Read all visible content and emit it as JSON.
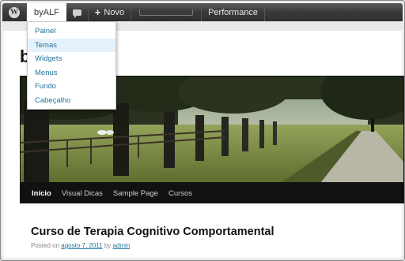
{
  "adminbar": {
    "wp_logo_icon": "wordpress-logo-icon",
    "site_name": "byALF",
    "comments_icon": "speech-bubble-icon",
    "new_label": "Novo",
    "performance_label": "Performance"
  },
  "site_menu": {
    "items": [
      {
        "label": "Painel"
      },
      {
        "label": "Temas"
      },
      {
        "label": "Widgets"
      },
      {
        "label": "Menus"
      },
      {
        "label": "Fundo"
      },
      {
        "label": "Cabeçalho"
      }
    ],
    "highlighted_index": 1
  },
  "site": {
    "title": "b"
  },
  "nav": {
    "items": [
      {
        "label": "Início"
      },
      {
        "label": "Visual Dicas"
      },
      {
        "label": "Sample Page"
      },
      {
        "label": "Cursos"
      }
    ]
  },
  "post": {
    "title": "Curso de Terapia Cognitivo Comportamental",
    "posted_on_label": "Posted on",
    "date": "agosto 7, 2011",
    "by_label": "by",
    "author": "admin"
  },
  "colors": {
    "link": "#21759b",
    "adminbar": "#3a3a3a",
    "nav_bg": "#111111"
  }
}
